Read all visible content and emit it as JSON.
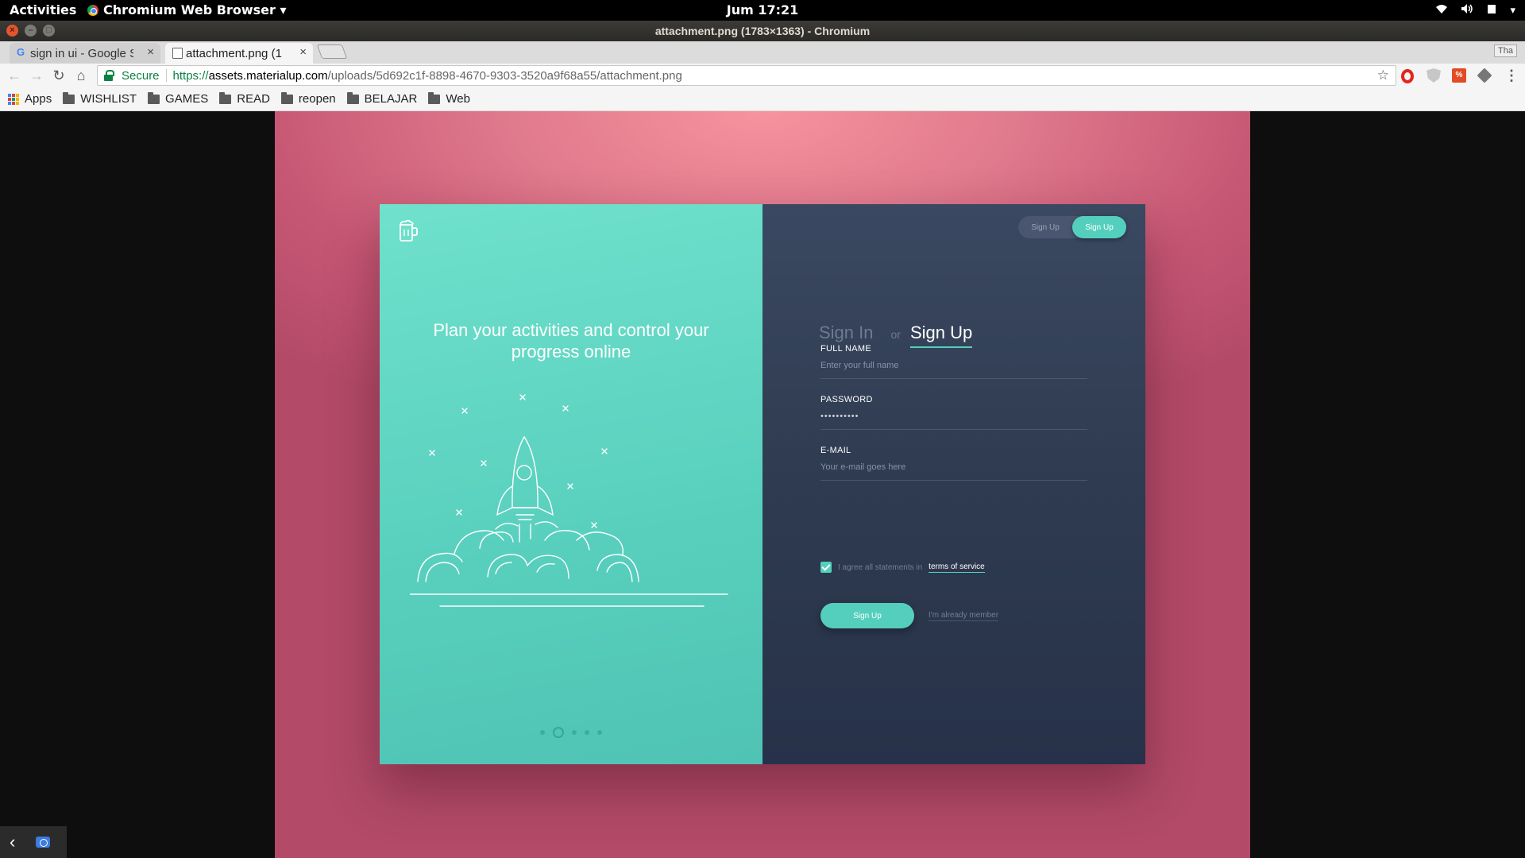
{
  "topbar": {
    "activities": "Activities",
    "app_menu": "Chromium Web Browser ▾",
    "clock": "Jum 17:21"
  },
  "window": {
    "title": "attachment.png (1783×1363) - Chromium"
  },
  "tabs": [
    {
      "label": "sign in ui - Google S",
      "icon": "google-icon",
      "active": false
    },
    {
      "label": "attachment.png (1",
      "icon": "file-icon",
      "active": true
    }
  ],
  "profile_label": "Tha",
  "omnibox": {
    "secure_label": "Secure",
    "url_protocol": "https://",
    "url_host": "assets.materialup.com",
    "url_path": "/uploads/5d692c1f-8898-4670-9303-3520a9f68a55/attachment.png"
  },
  "bookmarks": [
    {
      "label": "Apps",
      "icon": "apps-icon"
    },
    {
      "label": "WISHLIST",
      "icon": "folder-icon"
    },
    {
      "label": "GAMES",
      "icon": "folder-icon"
    },
    {
      "label": "READ",
      "icon": "folder-icon"
    },
    {
      "label": "reopen",
      "icon": "folder-icon"
    },
    {
      "label": "BELAJAR",
      "icon": "folder-icon"
    },
    {
      "label": "Web",
      "icon": "folder-icon"
    }
  ],
  "card": {
    "headline": "Plan your activities and control your progress online",
    "toggle": {
      "option_a": "Sign Up",
      "option_b": "Sign Up"
    },
    "tabs": {
      "sign_in": "Sign In",
      "or": "or",
      "sign_up": "Sign Up"
    },
    "fields": {
      "full_name": {
        "label": "FULL NAME",
        "placeholder": "Enter your full name"
      },
      "password": {
        "label": "PASSWORD",
        "value": "••••••••••"
      },
      "email": {
        "label": "E-MAIL",
        "placeholder": "Your e-mail goes here"
      }
    },
    "agree_text": "I agree all statements in",
    "tos_link": "terms of service",
    "submit_label": "Sign Up",
    "member_link": "I'm already member",
    "carousel_active_index": 2,
    "carousel_count": 5
  },
  "colors": {
    "accent": "#55cfbd",
    "panel_dark": "#2f3b50",
    "backdrop": "#e07a8d"
  }
}
